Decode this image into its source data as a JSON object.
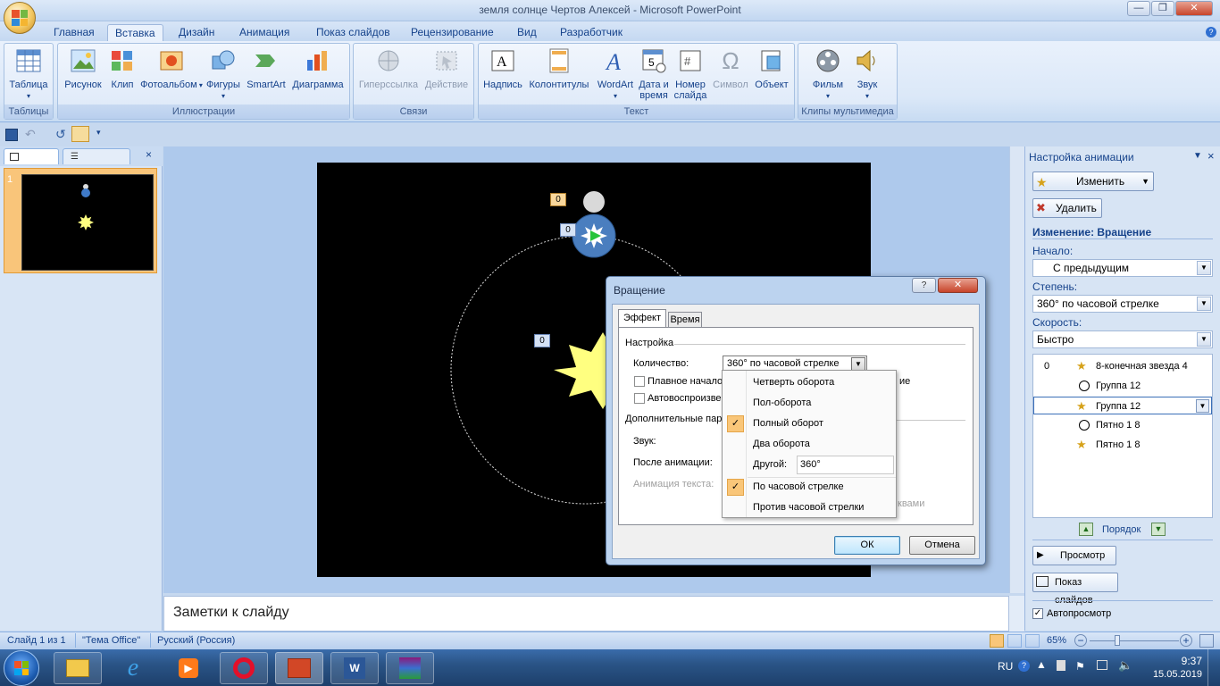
{
  "window": {
    "title": "земля солнце Чертов Алексей - Microsoft PowerPoint"
  },
  "tabs": [
    "Главная",
    "Вставка",
    "Дизайн",
    "Анимация",
    "Показ слайдов",
    "Рецензирование",
    "Вид",
    "Разработчик"
  ],
  "active_tab": "Вставка",
  "ribbon": {
    "groups": [
      {
        "label": "Таблицы",
        "buttons": [
          {
            "label": "Таблица"
          }
        ]
      },
      {
        "label": "Иллюстрации",
        "buttons": [
          {
            "label": "Рисунок"
          },
          {
            "label": "Клип"
          },
          {
            "label": "Фотоальбом"
          },
          {
            "label": "Фигуры"
          },
          {
            "label": "SmartArt"
          },
          {
            "label": "Диаграмма"
          }
        ]
      },
      {
        "label": "Связи",
        "buttons": [
          {
            "label": "Гиперссылка"
          },
          {
            "label": "Действие"
          }
        ]
      },
      {
        "label": "Текст",
        "buttons": [
          {
            "label": "Надпись"
          },
          {
            "label": "Колонтитулы"
          },
          {
            "label": "WordArt"
          },
          {
            "label": "Дата и время"
          },
          {
            "label": "Номер слайда"
          },
          {
            "label": "Символ"
          },
          {
            "label": "Объект"
          }
        ]
      },
      {
        "label": "Клипы мультимедиа",
        "buttons": [
          {
            "label": "Фильм"
          },
          {
            "label": "Звук"
          }
        ]
      }
    ]
  },
  "left_panel": {
    "slide_number": "1"
  },
  "slide_markers": [
    "0",
    "0",
    "0"
  ],
  "notes_placeholder": "Заметки к слайду",
  "animation_pane": {
    "title": "Настройка анимации",
    "change_button": "Изменить",
    "remove_button": "Удалить",
    "change_heading": "Изменение: Вращение",
    "start_label": "Начало:",
    "start_value": "С предыдущим",
    "amount_label": "Степень:",
    "amount_value": "360° по часовой стрелке",
    "speed_label": "Скорость:",
    "speed_value": "Быстро",
    "items": [
      {
        "index": "0",
        "label": "8-конечная звезда 4",
        "icon": "star-effect-icon"
      },
      {
        "index": "",
        "label": "Группа 12",
        "icon": "clock-icon"
      },
      {
        "index": "",
        "label": "Группа 12",
        "icon": "star-effect-icon"
      },
      {
        "index": "",
        "label": "Пятно 1 8",
        "icon": "clock-icon"
      },
      {
        "index": "",
        "label": "Пятно 1 8",
        "icon": "star-effect-icon"
      }
    ],
    "order_label": "Порядок",
    "preview_button": "Просмотр",
    "slideshow_button": "Показ слайдов",
    "autopreview_label": "Автопросмотр"
  },
  "dialog": {
    "title": "Вращение",
    "tabs": [
      "Эффект",
      "Время"
    ],
    "settings_heading": "Настройка",
    "amount_label": "Количество:",
    "amount_value": "360° по часовой стрелке",
    "smooth_start": "Плавное начало",
    "smooth_end_tail": "ие",
    "autoreverse": "Автовоспроизве",
    "extra_heading": "Дополнительные пар",
    "sound_label": "Звук:",
    "after_anim_label": "После анимации:",
    "text_anim_label": "Анимация текста:",
    "text_anim_tail": "квами",
    "ok": "ОК",
    "cancel": "Отмена"
  },
  "dropdown_menu": {
    "items": [
      "Четверть оборота",
      "Пол-оборота",
      "Полный оборот",
      "Два оборота"
    ],
    "other_label": "Другой:",
    "other_value": "360°",
    "direction_items": [
      "По часовой стрелке",
      "Против часовой стрелки"
    ],
    "checked": [
      "Полный оборот",
      "По часовой стрелке"
    ]
  },
  "status_bar": {
    "slide": "Слайд 1 из 1",
    "theme": "\"Тема Office\"",
    "language": "Русский (Россия)",
    "zoom": "65%"
  },
  "taskbar": {
    "lang": "RU",
    "time": "9:37",
    "date": "15.05.2019"
  }
}
